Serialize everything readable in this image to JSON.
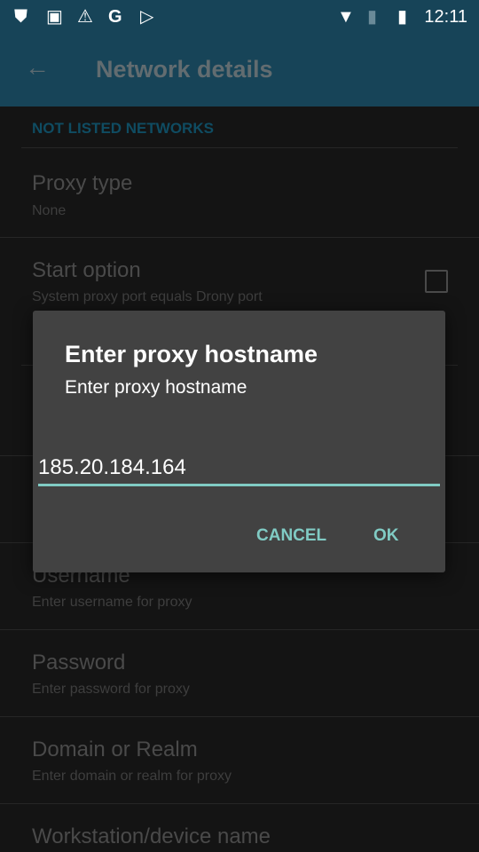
{
  "status_bar": {
    "icons": [
      "shield-play-icon",
      "image-icon",
      "warning-icon",
      "google-icon",
      "play-store-icon"
    ],
    "right_icons": [
      "wifi-icon",
      "no-sim-icon",
      "battery-charging-icon"
    ],
    "time": "12:11"
  },
  "app_bar": {
    "title": "Network details"
  },
  "section": "NOT LISTED NETWORKS",
  "items": [
    {
      "title": "Proxy type",
      "subtitle": "None"
    },
    {
      "title": "Start option",
      "subtitle": "System proxy port equals Drony port",
      "checked": false
    },
    {
      "title": "Username",
      "subtitle": "Enter username for proxy"
    },
    {
      "title": "Password",
      "subtitle": "Enter password for proxy"
    },
    {
      "title": "Domain or Realm",
      "subtitle": "Enter domain or realm for proxy"
    },
    {
      "title": "Workstation/device name"
    }
  ],
  "dialog": {
    "title": "Enter proxy hostname",
    "message": "Enter proxy hostname",
    "value": "185.20.184.164",
    "cancel": "CANCEL",
    "ok": "OK",
    "accent": "#80cbc4"
  }
}
